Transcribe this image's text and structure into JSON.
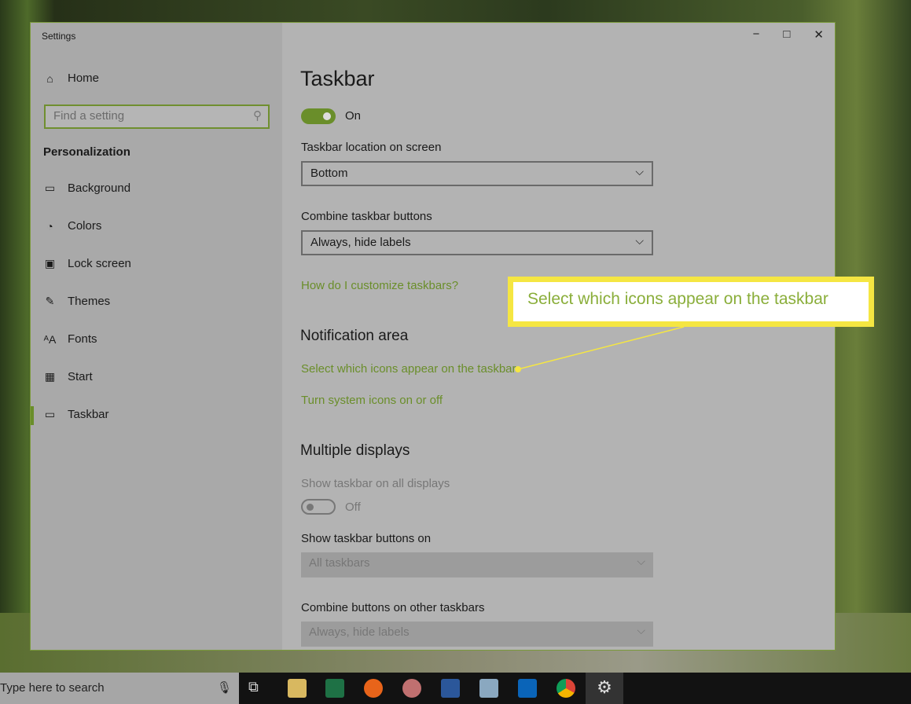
{
  "window": {
    "title": "Settings",
    "minimize": "−",
    "maximize": "□",
    "close": "✕"
  },
  "sidebar": {
    "home": "Home",
    "search_placeholder": "Find a setting",
    "section": "Personalization",
    "items": [
      {
        "label": "Background",
        "icon": "picture-icon",
        "glyph": "▭"
      },
      {
        "label": "Colors",
        "icon": "palette-icon",
        "glyph": "◔"
      },
      {
        "label": "Lock screen",
        "icon": "lock-screen-icon",
        "glyph": "▣"
      },
      {
        "label": "Themes",
        "icon": "themes-icon",
        "glyph": "✎"
      },
      {
        "label": "Fonts",
        "icon": "fonts-icon",
        "glyph": "ᴬA"
      },
      {
        "label": "Start",
        "icon": "start-icon",
        "glyph": "▦"
      },
      {
        "label": "Taskbar",
        "icon": "taskbar-icon",
        "glyph": "▭"
      }
    ],
    "selected": "Taskbar"
  },
  "main": {
    "title": "Taskbar",
    "toggle1": {
      "state": "On",
      "on": true
    },
    "location_label": "Taskbar location on screen",
    "location_value": "Bottom",
    "combine_label": "Combine taskbar buttons",
    "combine_value": "Always, hide labels",
    "help_link": "How do I customize taskbars?",
    "notification_heading": "Notification area",
    "notif_link1": "Select which icons appear on the taskbar",
    "notif_link2": "Turn system icons on or off",
    "multi_heading": "Multiple displays",
    "show_all_label": "Show taskbar on all displays",
    "show_all_state": "Off",
    "show_buttons_label": "Show taskbar buttons on",
    "show_buttons_value": "All taskbars",
    "combine_other_label": "Combine buttons on other taskbars",
    "combine_other_value": "Always, hide labels"
  },
  "callout": {
    "text": "Select which icons appear on the taskbar"
  },
  "taskbar": {
    "search_placeholder": "Type here to search"
  },
  "colors": {
    "accent": "#6a8e2a",
    "callout": "#f5e642"
  }
}
